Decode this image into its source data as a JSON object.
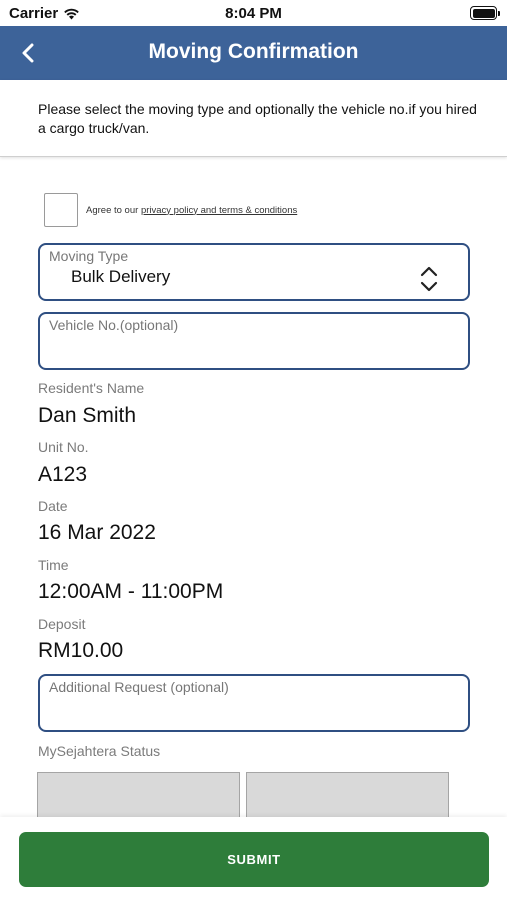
{
  "status_bar": {
    "carrier": "Carrier",
    "time": "8:04 PM",
    "icons": [
      "wifi-icon",
      "battery-icon"
    ]
  },
  "nav": {
    "title": "Moving Confirmation",
    "back_icon": "chevron-left-icon",
    "background_color": "#3d6399"
  },
  "instruction": "Please select the moving type and optionally the vehicle no.if you hired a cargo truck/van.",
  "agreement": {
    "checked": false,
    "prefix": "Agree to our",
    "link_text": "privacy policy and terms & conditions"
  },
  "moving_type": {
    "label": "Moving Type",
    "value": "Bulk Delivery",
    "icon": "up-down-chevron-icon"
  },
  "vehicle": {
    "placeholder": "Vehicle No.(optional)",
    "value": ""
  },
  "details": {
    "resident_name_label": "Resident's Name",
    "resident_name": "Dan Smith",
    "unit_label": "Unit No.",
    "unit": "A123",
    "date_label": "Date",
    "date": "16 Mar 2022",
    "time_label": "Time",
    "time": "12:00AM - 11:00PM",
    "deposit_label": "Deposit",
    "deposit": "RM10.00"
  },
  "additional_request": {
    "placeholder": "Additional Request (optional)",
    "value": ""
  },
  "mysejahtera": {
    "label": "MySejahtera Status"
  },
  "submit": {
    "label": "SUBMIT",
    "color": "#2e7d3a"
  }
}
